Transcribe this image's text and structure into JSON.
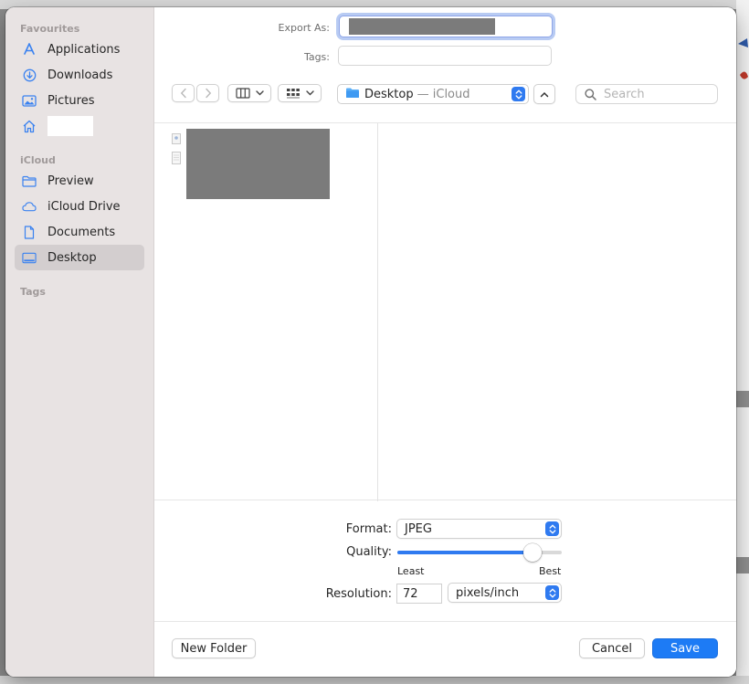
{
  "sidebar": {
    "sections": {
      "favourites": "Favourites",
      "icloud": "iCloud",
      "tags": "Tags"
    },
    "favourites": [
      {
        "label": "Applications",
        "icon": "applications-icon"
      },
      {
        "label": "Downloads",
        "icon": "downloads-icon"
      },
      {
        "label": "Pictures",
        "icon": "pictures-icon"
      },
      {
        "label": "",
        "icon": "home-icon"
      }
    ],
    "icloud_items": [
      {
        "label": "Preview",
        "icon": "folder-icon"
      },
      {
        "label": "iCloud Drive",
        "icon": "cloud-icon"
      },
      {
        "label": "Documents",
        "icon": "document-icon"
      },
      {
        "label": "Desktop",
        "icon": "desktop-icon",
        "selected": true
      }
    ]
  },
  "header": {
    "export_as_label": "Export As:",
    "export_as_value": "",
    "tags_label": "Tags:"
  },
  "toolbar": {
    "location_name": "Desktop",
    "location_sub": "— iCloud",
    "search_placeholder": "Search"
  },
  "options": {
    "format_label": "Format:",
    "format_value": "JPEG",
    "quality_label": "Quality:",
    "quality_fraction": 0.82,
    "quality_min_label": "Least",
    "quality_max_label": "Best",
    "resolution_label": "Resolution:",
    "resolution_value": "72",
    "resolution_unit": "pixels/inch"
  },
  "footer": {
    "new_folder": "New Folder",
    "cancel": "Cancel",
    "save": "Save"
  },
  "colors": {
    "accent": "#1d7bf5",
    "sidebar_bg": "#e8e3e3",
    "sidebar_icon": "#3a82f0"
  }
}
